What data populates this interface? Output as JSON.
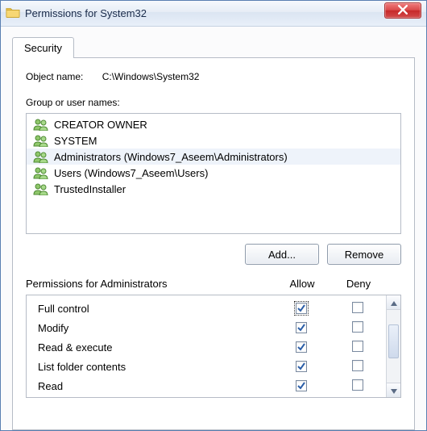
{
  "title": "Permissions for System32",
  "tab_security": "Security",
  "objectname_label": "Object name:",
  "objectname_value": "C:\\Windows\\System32",
  "groupusers_label": "Group or user names:",
  "principals": [
    {
      "name": "CREATOR OWNER"
    },
    {
      "name": "SYSTEM"
    },
    {
      "name": "Administrators (Windows7_Aseem\\Administrators)",
      "selected": true
    },
    {
      "name": "Users (Windows7_Aseem\\Users)"
    },
    {
      "name": "TrustedInstaller"
    }
  ],
  "add_label": "Add...",
  "remove_label": "Remove",
  "permissions_for_label": "Permissions for Administrators",
  "col_allow": "Allow",
  "col_deny": "Deny",
  "permissions": [
    {
      "name": "Full control",
      "allow": true,
      "deny": false,
      "focused": true
    },
    {
      "name": "Modify",
      "allow": true,
      "deny": false
    },
    {
      "name": "Read & execute",
      "allow": true,
      "deny": false
    },
    {
      "name": "List folder contents",
      "allow": true,
      "deny": false
    },
    {
      "name": "Read",
      "allow": true,
      "deny": false
    }
  ]
}
